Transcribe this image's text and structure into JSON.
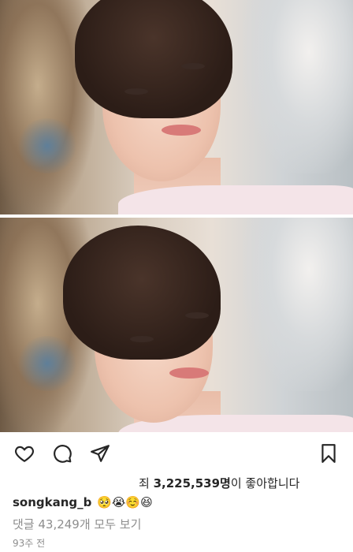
{
  "post": {
    "likes_prefix": "죄",
    "likes_count": "3,225,539명",
    "likes_suffix": "이 좋아합니다",
    "username": "songkang_b",
    "emojis": "🥺😭☺️😆",
    "comments_link": "댓글 43,249개 모두 보기",
    "timestamp": "93주 전"
  },
  "icons": [
    "heart-icon",
    "comment-icon",
    "share-icon",
    "bookmark-icon"
  ]
}
